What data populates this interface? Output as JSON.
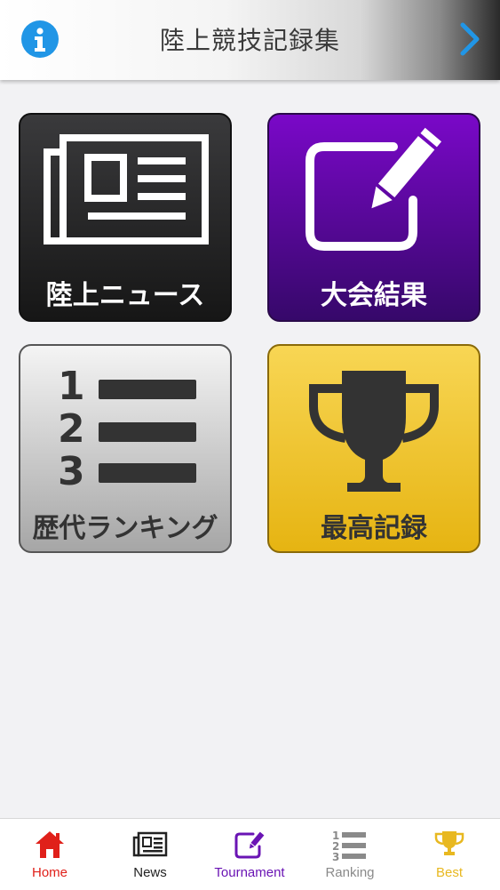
{
  "header": {
    "title": "陸上競技記録集",
    "info_icon": "info-icon",
    "next_icon": "chevron-right-icon"
  },
  "tiles": [
    {
      "id": "news",
      "label": "陸上ニュース",
      "icon": "newspaper-icon"
    },
    {
      "id": "tournament",
      "label": "大会結果",
      "icon": "edit-icon"
    },
    {
      "id": "ranking",
      "label": "歴代ランキング",
      "icon": "ranking-list-icon"
    },
    {
      "id": "best",
      "label": "最高記録",
      "icon": "trophy-icon"
    }
  ],
  "tabbar": {
    "items": [
      {
        "label": "Home",
        "icon": "home-icon",
        "color": "#e0201a"
      },
      {
        "label": "News",
        "icon": "newspaper-icon",
        "color": "#222222"
      },
      {
        "label": "Tournament",
        "icon": "edit-icon",
        "color": "#6a14b4"
      },
      {
        "label": "Ranking",
        "icon": "ranking-list-icon",
        "color": "#8a8a8a"
      },
      {
        "label": "Best",
        "icon": "trophy-icon",
        "color": "#e8b820"
      }
    ]
  },
  "colors": {
    "info": "#2196e6",
    "news_tile": "#2a2a2a",
    "tournament_tile": "#5a0aa8",
    "ranking_tile": "#d0d0d0",
    "best_tile": "#f0c83a"
  }
}
